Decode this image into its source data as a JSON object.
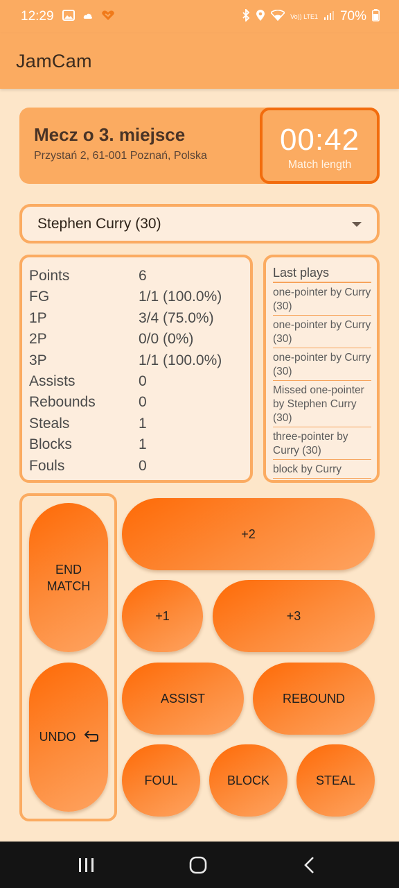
{
  "status_bar": {
    "time": "12:29",
    "battery": "70%",
    "network_label": "Vo)) LTE1"
  },
  "app": {
    "title": "JamCam"
  },
  "match": {
    "name": "Mecz o 3. miejsce",
    "address": "Przystań 2, 61-001 Poznań, Polska",
    "time": "00:42",
    "time_label": "Match length"
  },
  "player_select": {
    "value": "Stephen Curry (30)"
  },
  "stats": [
    {
      "label": "Points",
      "value": "6"
    },
    {
      "label": "FG",
      "value": "1/1 (100.0%)"
    },
    {
      "label": "1P",
      "value": "3/4 (75.0%)"
    },
    {
      "label": "2P",
      "value": "0/0 (0%)"
    },
    {
      "label": "3P",
      "value": "1/1 (100.0%)"
    },
    {
      "label": "Assists",
      "value": "0"
    },
    {
      "label": "Rebounds",
      "value": "0"
    },
    {
      "label": "Steals",
      "value": "1"
    },
    {
      "label": "Blocks",
      "value": "1"
    },
    {
      "label": "Fouls",
      "value": "0"
    }
  ],
  "last_plays": {
    "title": "Last plays",
    "items": [
      "one-pointer by Curry (30)",
      "one-pointer by Curry (30)",
      "one-pointer by Curry (30)",
      "Missed one-pointer by Stephen Curry (30)",
      "three-pointer by Curry (30)",
      "block by Curry"
    ]
  },
  "buttons": {
    "end_match": "END MATCH",
    "undo": "UNDO",
    "plus_two": "+2",
    "plus_one": "+1",
    "plus_three": "+3",
    "assist": "ASSIST",
    "rebound": "REBOUND",
    "foul": "FOUL",
    "block": "BLOCK",
    "steal": "STEAL"
  },
  "colors": {
    "app_bar": "#fbab61",
    "background": "#fde6c9",
    "accent": "#f26c0d",
    "button_gradient_start": "#fe6a06",
    "button_gradient_end": "#fea360"
  },
  "icons": [
    "image-icon",
    "cloud-icon",
    "heart-icon",
    "bluetooth-icon",
    "location-icon",
    "wifi-icon",
    "signal-icon",
    "battery-icon",
    "recent-apps-icon",
    "home-icon",
    "back-icon",
    "undo-arrow-icon",
    "dropdown-caret-icon"
  ]
}
